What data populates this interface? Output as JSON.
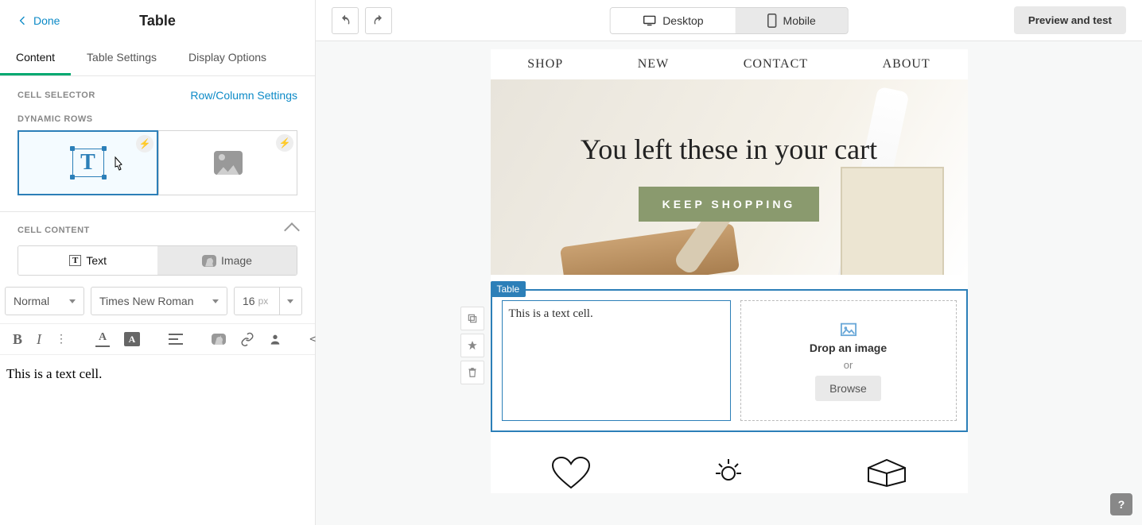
{
  "header": {
    "done": "Done",
    "title": "Table",
    "preview": "Preview and test"
  },
  "tabs": {
    "content": "Content",
    "table_settings": "Table Settings",
    "display_options": "Display Options"
  },
  "cell_selector": {
    "label": "CELL SELECTOR",
    "row_col": "Row/Column Settings"
  },
  "dynamic_rows": {
    "label": "DYNAMIC ROWS"
  },
  "cell_content": {
    "label": "CELL CONTENT",
    "text": "Text",
    "image": "Image"
  },
  "format": {
    "style": "Normal",
    "font": "Times New Roman",
    "size": "16",
    "size_unit": "px"
  },
  "editor_text": "This is a text cell.",
  "device": {
    "desktop": "Desktop",
    "mobile": "Mobile"
  },
  "email": {
    "nav": [
      "SHOP",
      "NEW",
      "CONTACT",
      "ABOUT"
    ],
    "hero_title": "You left these in your cart",
    "hero_cta": "KEEP SHOPPING",
    "table_label": "Table",
    "text_cell": "This is a text cell.",
    "drop_title": "Drop an image",
    "drop_or": "or",
    "browse": "Browse"
  },
  "help": "?"
}
